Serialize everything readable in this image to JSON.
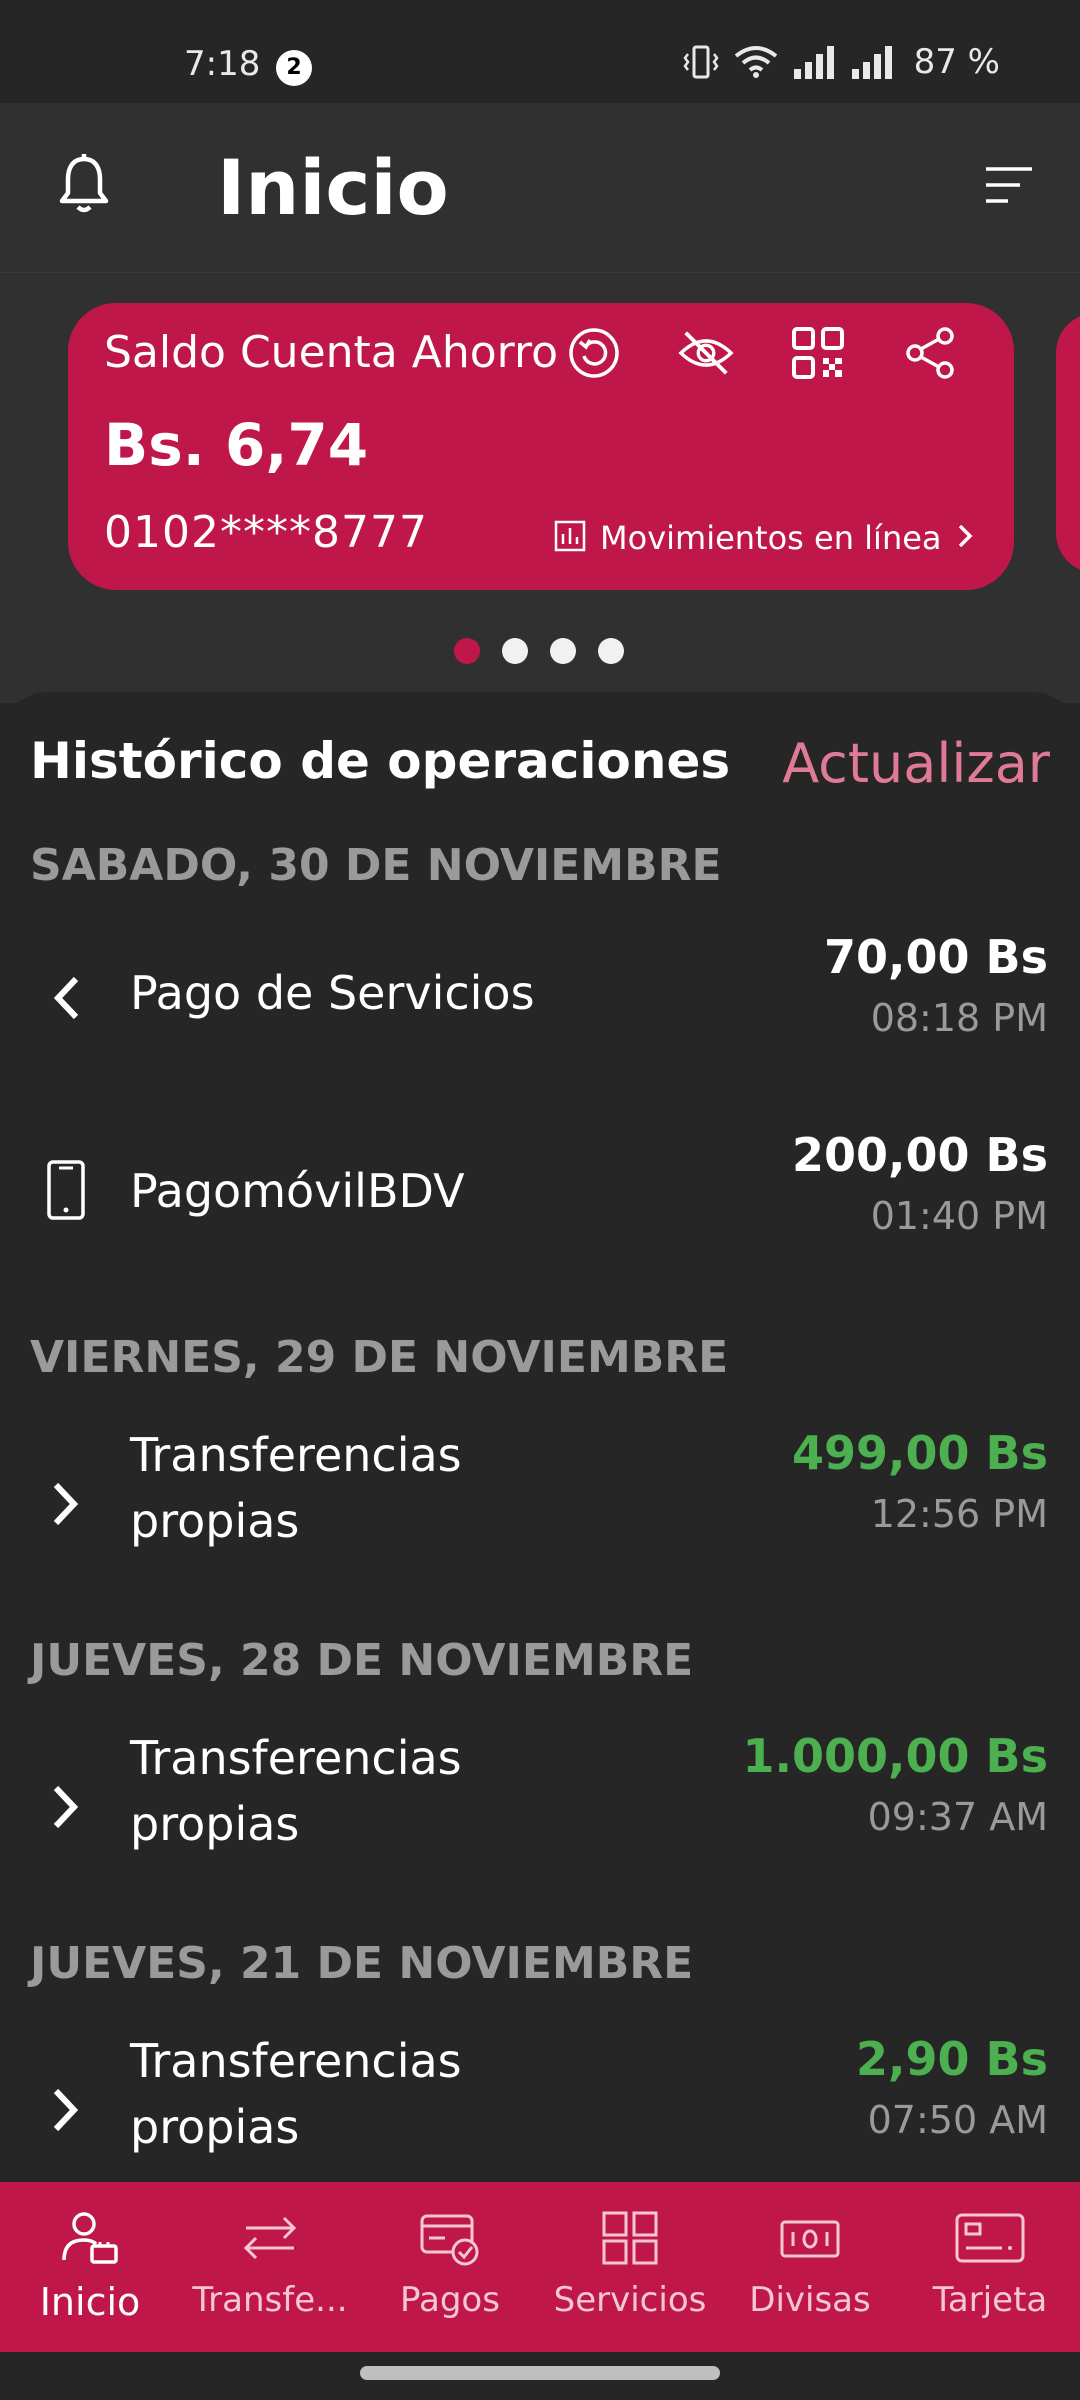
{
  "status_bar": {
    "time": "7:18",
    "notification_count": "2",
    "battery": "87 %"
  },
  "header": {
    "title": "Inicio",
    "bell_icon": "bell-icon",
    "menu_icon": "filter-menu-icon"
  },
  "account_card": {
    "title": "Saldo Cuenta Ahorro",
    "balance": "Bs. 6,74",
    "account_number": "0102****8777",
    "movements_link": "Movimientos en línea",
    "icons": [
      "refresh-icon",
      "eye-off-icon",
      "qr-code-icon",
      "share-icon"
    ],
    "color": "#c0174a"
  },
  "carousel": {
    "page_count": 4,
    "active_index": 0
  },
  "history": {
    "title": "Histórico de operaciones",
    "refresh_label": "Actualizar",
    "groups": [
      {
        "date": "SABADO, 30 DE NOVIEMBRE",
        "items": [
          {
            "name": "Pago de Servicios",
            "amount": "70,00 Bs",
            "time": "08:18 PM",
            "icon": "chevron-left-icon",
            "credit": false
          },
          {
            "name": "PagomóvilBDV",
            "amount": "200,00 Bs",
            "time": "01:40 PM",
            "icon": "phone-icon",
            "credit": false
          }
        ]
      },
      {
        "date": "VIERNES, 29 DE NOVIEMBRE",
        "items": [
          {
            "name": "Transferencias propias",
            "amount": "499,00 Bs",
            "time": "12:56 PM",
            "icon": "chevron-right-icon",
            "credit": true
          }
        ]
      },
      {
        "date": "JUEVES, 28 DE NOVIEMBRE",
        "items": [
          {
            "name": "Transferencias propias",
            "amount": "1.000,00 Bs",
            "time": "09:37 AM",
            "icon": "chevron-right-icon",
            "credit": true
          }
        ]
      },
      {
        "date": "JUEVES, 21 DE NOVIEMBRE",
        "items": [
          {
            "name": "Transferencias propias",
            "amount": "2,90 Bs",
            "time": "07:50 AM",
            "icon": "chevron-right-icon",
            "credit": true
          }
        ]
      }
    ]
  },
  "bottom_nav": {
    "items": [
      {
        "label": "Inicio",
        "icon": "user-home-icon",
        "active": true
      },
      {
        "label": "Transfe...",
        "icon": "transfer-arrows-icon",
        "active": false
      },
      {
        "label": "Pagos",
        "icon": "card-check-icon",
        "active": false
      },
      {
        "label": "Servicios",
        "icon": "grid-icon",
        "active": false
      },
      {
        "label": "Divisas",
        "icon": "currency-note-icon",
        "active": false
      },
      {
        "label": "Tarjeta",
        "icon": "card-icon",
        "active": false
      }
    ]
  },
  "colors": {
    "accent": "#c0174a",
    "refresh_text": "#e07a97",
    "credit_amount": "#4caf50",
    "background": "#262626"
  }
}
